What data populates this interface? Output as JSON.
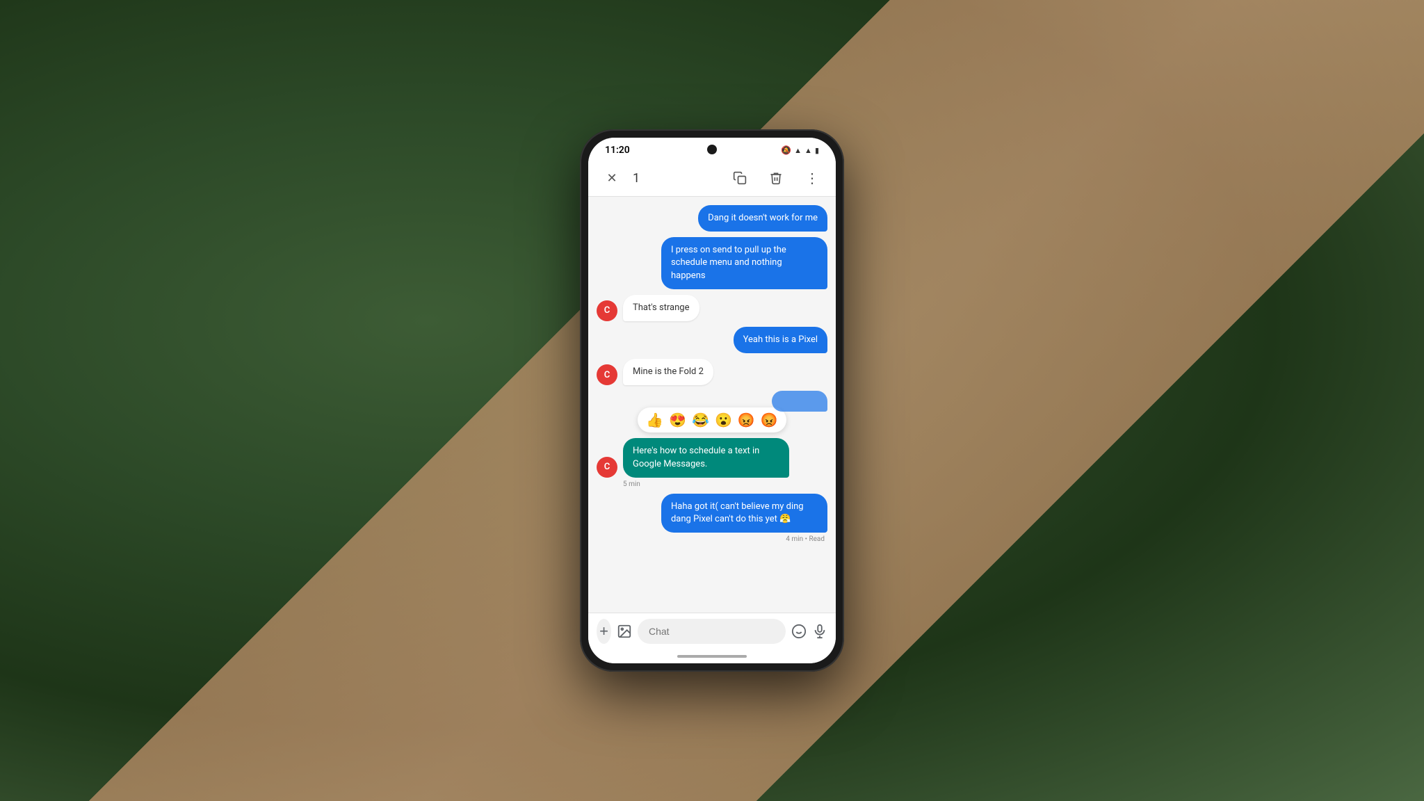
{
  "background": {
    "color": "#4a6741"
  },
  "phone": {
    "status_bar": {
      "time": "11:20",
      "volume_icon": "🔔",
      "wifi": "▲",
      "signal": "▲",
      "battery": "▪"
    },
    "action_bar": {
      "close_icon": "✕",
      "count": "1",
      "copy_icon": "⧉",
      "delete_icon": "🗑",
      "more_icon": "⋮"
    },
    "messages": [
      {
        "id": "msg1",
        "type": "sent",
        "text": "Dang it doesn't work for me",
        "color": "blue"
      },
      {
        "id": "msg2",
        "type": "sent",
        "text": "I press on send to pull up the schedule menu and nothing happens",
        "color": "blue"
      },
      {
        "id": "msg3",
        "type": "received",
        "avatar": "C",
        "text": "That's strange",
        "color": "white"
      },
      {
        "id": "msg4",
        "type": "sent",
        "text": "Yeah this is a Pixel",
        "color": "blue"
      },
      {
        "id": "msg5",
        "type": "received",
        "avatar": "C",
        "text": "Mine is the Fold 2",
        "color": "white"
      },
      {
        "id": "msg6",
        "type": "sent_partial",
        "text": "",
        "color": "blue",
        "has_emoji_bar": true,
        "emojis": [
          "👍",
          "😍",
          "😂",
          "😮",
          "😡",
          "😡"
        ]
      },
      {
        "id": "msg7",
        "type": "received",
        "avatar": "C",
        "text": "Here's how to schedule a text in Google Messages.",
        "color": "teal",
        "timestamp": "5 min"
      },
      {
        "id": "msg8",
        "type": "sent",
        "text": "Haha got it( can't believe my ding dang Pixel can't do this yet 😤",
        "color": "blue",
        "timestamp": "4 min • Read"
      }
    ],
    "input_bar": {
      "add_icon": "+",
      "image_icon": "🖼",
      "placeholder": "Chat",
      "emoji_icon": "😊",
      "mic_icon": "🎤"
    }
  }
}
